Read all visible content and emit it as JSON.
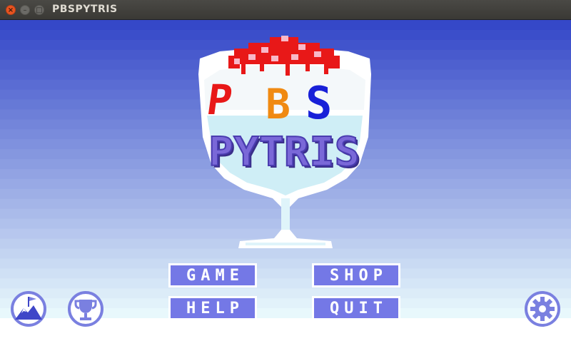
{
  "window": {
    "title": "PBSPYTRIS",
    "close_glyph": "×",
    "minimize_glyph": "–",
    "maximize_glyph": "□"
  },
  "logo": {
    "top_line": [
      "P",
      "B",
      "S"
    ],
    "bottom_line": "PYTRIS",
    "colors": {
      "p": "#e81818",
      "b": "#f08a12",
      "s": "#1820d8",
      "pytris": "#6a5ad0",
      "cup": "#d8f2f8",
      "cherry": "#e81818"
    }
  },
  "menu": {
    "game": "GAME",
    "shop": "SHOP",
    "help": "HELP",
    "quit": "QUIT"
  },
  "icons": {
    "left_1": "mountain-flag-icon",
    "left_2": "trophy-icon",
    "right": "gear-icon"
  },
  "colors": {
    "button_fill": "#7478e6",
    "button_border": "#ffffff",
    "icon_ring": "#7a80e0",
    "sky_top": "#3548c8",
    "sky_bottom": "#e8f8fc"
  }
}
